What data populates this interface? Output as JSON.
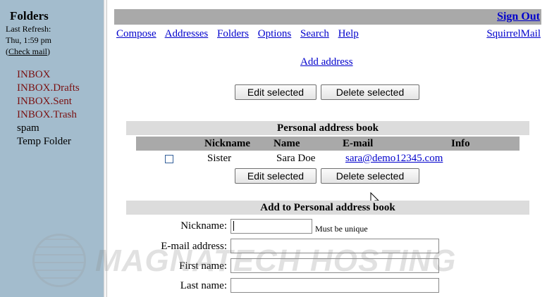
{
  "sidebar": {
    "title": "Folders",
    "last_refresh_label": "Last Refresh:",
    "last_refresh_time": "Thu, 1:59 pm",
    "check_mail_open": "(",
    "check_mail": "Check mail",
    "check_mail_close": ")",
    "folders": [
      {
        "label": "INBOX",
        "link": true
      },
      {
        "label": "INBOX.Drafts",
        "link": true
      },
      {
        "label": "INBOX.Sent",
        "link": true
      },
      {
        "label": "INBOX.Trash",
        "link": true
      },
      {
        "label": "spam",
        "link": false
      },
      {
        "label": "Temp Folder",
        "link": false
      }
    ]
  },
  "topbar": {
    "sign_out": "Sign Out"
  },
  "nav": {
    "items": [
      "Compose",
      "Addresses",
      "Folders",
      "Options",
      "Search",
      "Help"
    ],
    "brand": "SquirrelMail"
  },
  "add_address_link": "Add address",
  "buttons": {
    "edit_selected": "Edit selected",
    "delete_selected": "Delete selected"
  },
  "address_book": {
    "title": "Personal address book",
    "columns": [
      "Nickname",
      "Name",
      "E-mail",
      "Info"
    ],
    "rows": [
      {
        "nickname": "Sister",
        "name": "Sara Doe",
        "email": "sara@demo12345.com",
        "info": "",
        "checked": false
      }
    ]
  },
  "add_form": {
    "title": "Add to Personal address book",
    "fields": [
      {
        "label": "Nickname:",
        "value": "",
        "hint": "Must be unique"
      },
      {
        "label": "E-mail address:",
        "value": ""
      },
      {
        "label": "First name:",
        "value": ""
      },
      {
        "label": "Last name:",
        "value": ""
      }
    ]
  },
  "watermark": "MAGNATECH HOSTING"
}
